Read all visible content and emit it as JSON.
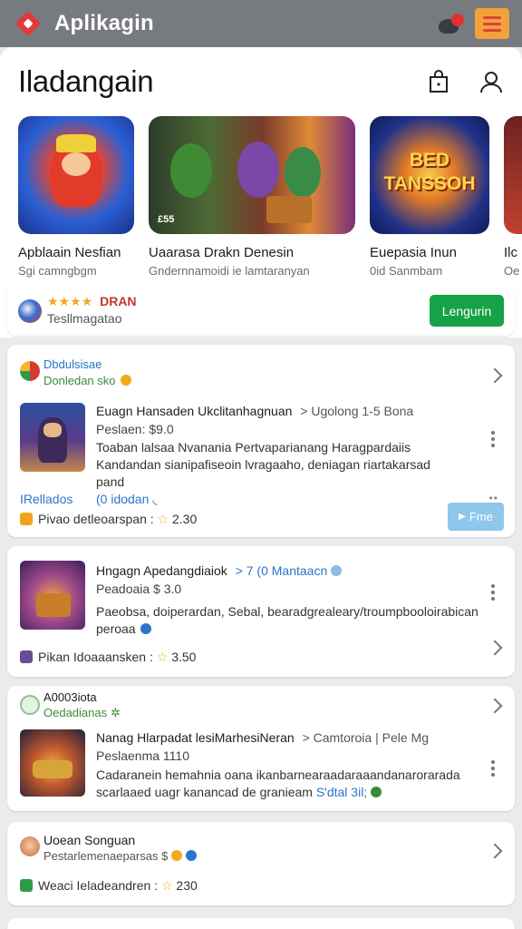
{
  "appbar": {
    "title": "Aplikagin"
  },
  "header": {
    "title": "Iladangain"
  },
  "carousel": [
    {
      "title": "Apblaain Nesfian",
      "sub": "Sgi camngbgm",
      "caption": ""
    },
    {
      "title": "Uaarasa Drakn Denesin",
      "sub": "Gndernnamoidi ie lamtaranyan",
      "caption": "£55"
    },
    {
      "title": "Euepasia Inun",
      "sub": "0id Sanmbam",
      "logo": "BED TANSSOH"
    },
    {
      "title": "Ilc",
      "sub": "Oe"
    }
  ],
  "rating_card": {
    "stars": "★★★★",
    "tag": "DRAN",
    "sub": "Tesllmagatao",
    "button": "Lengurin"
  },
  "card1": {
    "section_title": "Dbdulsisae",
    "section_sub": "Donledan sko",
    "app_title": "Euagn Hansaden Ukclitanhagnuan",
    "app_meta": "> Ugolong 1-5 Bona",
    "price": "Peslaen: $9.0",
    "desc1": "Toaban lalsaa Nvanania Pertvaparianang Haragpardaiis",
    "desc2": "Kandandan sianipafiseoin lvragaaho, deniagan riartakarsad",
    "desc3": "pand",
    "link1": "IRellados",
    "link2": "(0 idodan",
    "footer": "Pivao detleoarspan :",
    "footer_rating": "2.30",
    "button": "Fme"
  },
  "card2": {
    "app_title": "Hngagn Apedangdiaiok",
    "app_meta": "> 7 (0 Mantaacn",
    "price": "Peadoaia $ 3.0",
    "desc1": "Paeobsa, doiperardan, Sebal, bearadgrealeary/troumpbooloirabican",
    "desc2": "peroaa",
    "footer": "Pikan Idoaaansken :",
    "footer_rating": "3.50"
  },
  "card3": {
    "section_title": "A0003iota",
    "section_sub": "Oedadianas",
    "app_title": "Nanag Hlarpadat lesiMarhesiNeran",
    "app_meta": "> Camtoroia | Pele Mg",
    "price": "Peslaenma 1110",
    "desc1": "Cadaranein hemahnia oana ikanbarnearaadaraaandanarorarada",
    "desc2": "scarlaaed uagr kanancad de granieam",
    "desc_hl": "S'dtal 3il;"
  },
  "card4": {
    "title": "Uoean Songuan",
    "sub": "Pestarlemenaeparsas $",
    "footer": "Weaci Ieladeandren :",
    "footer_rating": "230"
  },
  "colors": {
    "appbar": "#777a7e",
    "green_button": "#16a246",
    "link_blue": "#2a75c7",
    "star": "#f0a81c"
  }
}
